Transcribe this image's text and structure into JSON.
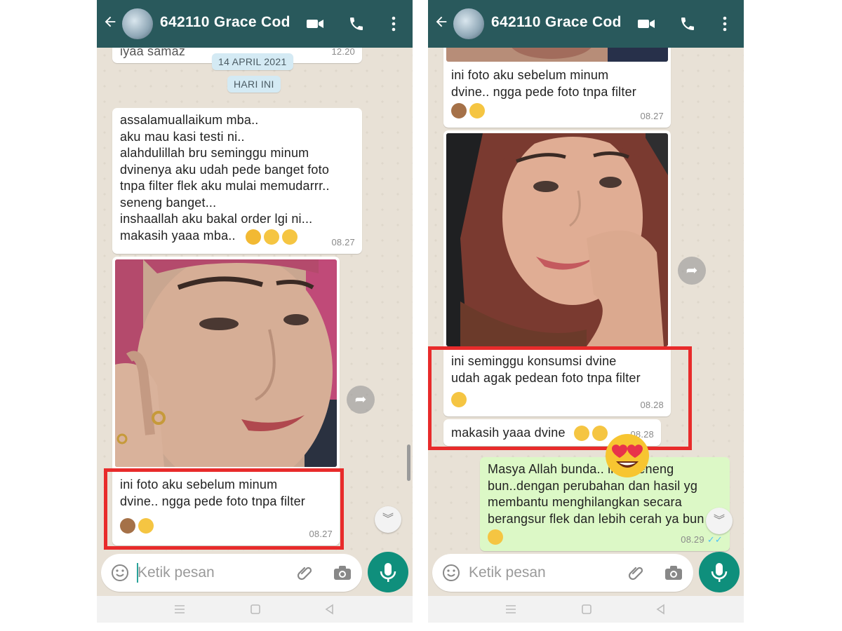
{
  "left": {
    "header": {
      "contact_name": "642110 Grace Cod"
    },
    "prev_message_partial": {
      "text": "iyaa samaz",
      "time": "12.20"
    },
    "date_pills": {
      "date": "14 APRIL 2021",
      "today": "HARI INI"
    },
    "messages": [
      {
        "text": "assalamuallaikum mba..\naku mau kasi testi ni..\nalahdulillah bru seminggu minum\ndvinenya aku udah pede banget foto\ntnpa filter flek aku mulai memudarrr..\nseneng banget...\ninshaallah aku bakal order lgi ni...\nmakasih yaaa mba..",
        "time": "08.27"
      },
      {
        "text": "ini foto aku sebelum minum\ndvine.. ngga pede foto tnpa filter",
        "time": "08.27"
      }
    ],
    "input": {
      "placeholder": "Ketik pesan"
    }
  },
  "right": {
    "header": {
      "contact_name": "642110 Grace Cod"
    },
    "messages": [
      {
        "text": "ini foto aku sebelum minum\ndvine.. ngga pede foto tnpa filter",
        "time": "08.27"
      },
      {
        "text": "ini seminggu konsumsi dvine\nudah agak pedean foto tnpa filter",
        "time": "08.28"
      },
      {
        "text": "makasih yaaa dvine",
        "time": "08.28"
      },
      {
        "text": "Masya Allah bunda.. ikut seneng\nbun..dengan perubahan dan hasil yg\nmembantu menghilangkan secara\nberangsur flek dan lebih cerah ya bun",
        "time": "08.29",
        "ticks": "✓✓"
      }
    ],
    "input": {
      "placeholder": "Ketik pesan"
    }
  },
  "colors": {
    "header": "#29595c",
    "chat_bg": "#e8e1d6",
    "outgoing": "#dcf8c6",
    "highlight": "#e82b2b",
    "mic": "#0f8f7c"
  },
  "icons": [
    "back-arrow-icon",
    "video-call-icon",
    "phone-icon",
    "more-vert-icon",
    "emoji-icon",
    "attach-icon",
    "camera-icon",
    "mic-icon",
    "forward-icon",
    "scroll-down-icon"
  ]
}
